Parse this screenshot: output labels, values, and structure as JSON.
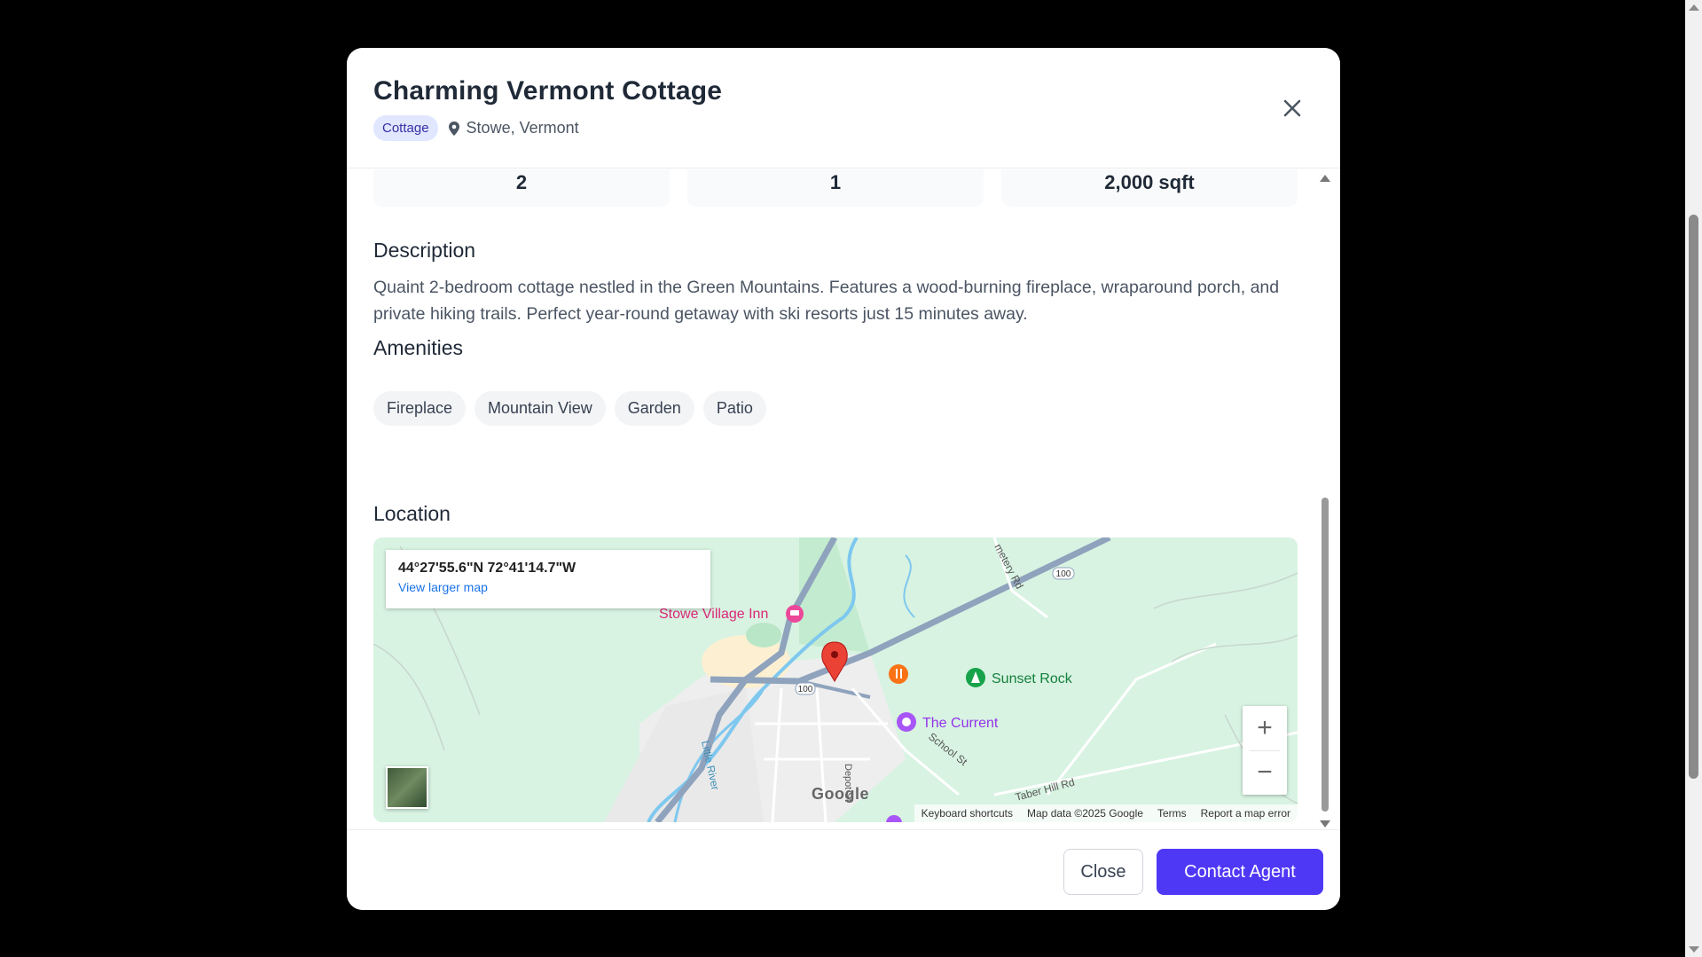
{
  "modal": {
    "title": "Charming Vermont Cottage",
    "type_badge": "Cottage",
    "location": "Stowe, Vermont"
  },
  "stats": [
    "2",
    "1",
    "2,000 sqft"
  ],
  "description": {
    "heading": "Description",
    "text": "Quaint 2-bedroom cottage nestled in the Green Mountains. Features a wood-burning fireplace, wraparound porch, and private hiking trails. Perfect year-round getaway with ski resorts just 15 minutes away."
  },
  "amenities": {
    "heading": "Amenities",
    "items": [
      "Fireplace",
      "Mountain View",
      "Garden",
      "Patio"
    ]
  },
  "location_section": {
    "heading": "Location",
    "map": {
      "coords": "44°27'55.6\"N 72°41'14.7\"W",
      "view_larger": "View larger map",
      "places": {
        "inn": "Stowe Village Inn",
        "rock": "Sunset Rock",
        "current": "The Current"
      },
      "roads": {
        "r100a": "100",
        "r100b": "100",
        "cemetery": "metery Rd",
        "school": "School St",
        "taber": "Taber Hill Rd",
        "river": "Little River",
        "depot": "Depot St"
      },
      "footer": {
        "shortcuts": "Keyboard shortcuts",
        "mapdata": "Map data ©2025 Google",
        "terms": "Terms",
        "report": "Report a map error"
      },
      "logo": "Google",
      "zoom_in": "+",
      "zoom_out": "−"
    }
  },
  "footer": {
    "close": "Close",
    "contact": "Contact Agent"
  },
  "colors": {
    "accent": "#4f38f5",
    "badge_bg": "#e0e7ff",
    "map_green": "#d8f3e2",
    "pin_red": "#ea4335"
  }
}
